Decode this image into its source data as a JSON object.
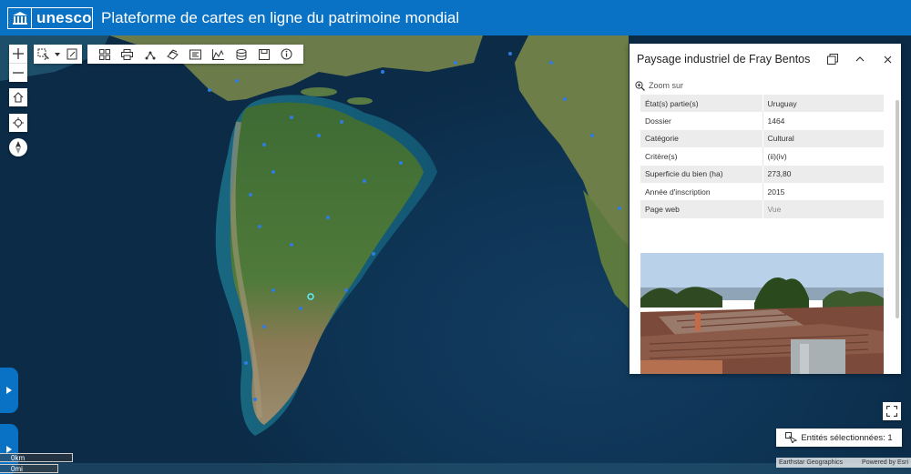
{
  "header": {
    "logo_text": "unesco",
    "title": "Plateforme de cartes en ligne du patrimoine mondial",
    "bg_color": "#0a72c5"
  },
  "map_controls": {
    "zoom_in_icon": "plus-icon",
    "zoom_out_icon": "minus-icon",
    "home_icon": "home-icon",
    "locate_icon": "crosshair-icon",
    "compass_icon": "compass-icon"
  },
  "toolbar": {
    "group_a": [
      "select-icon",
      "dropdown-arrow-icon",
      "draw-icon"
    ],
    "group_b": [
      "grid-icon",
      "print-icon",
      "share-icon",
      "layers-icon",
      "legend-icon",
      "chart-icon",
      "database-icon",
      "save-icon",
      "info-icon"
    ]
  },
  "popup": {
    "title": "Paysage industriel de Fray Bentos",
    "zoom_label": "Zoom sur",
    "attributes": [
      {
        "key": "État(s) partie(s)",
        "value": "Uruguay"
      },
      {
        "key": "Dossier",
        "value": "1464"
      },
      {
        "key": "Catégorie",
        "value": "Cultural"
      },
      {
        "key": "Critère(s)",
        "value": "(ii)(iv)"
      },
      {
        "key": "Superficie du bien (ha)",
        "value": "273,80"
      },
      {
        "key": "Année d'inscription",
        "value": "2015"
      },
      {
        "key": "Page web",
        "value": "Vue"
      }
    ]
  },
  "selection": {
    "label": "Entités sélectionnées: 1"
  },
  "scale": {
    "km": "0km",
    "mi": "0mi"
  },
  "attribution": {
    "source": "Earthstar Geographics",
    "powered": "Powered by Esri"
  }
}
